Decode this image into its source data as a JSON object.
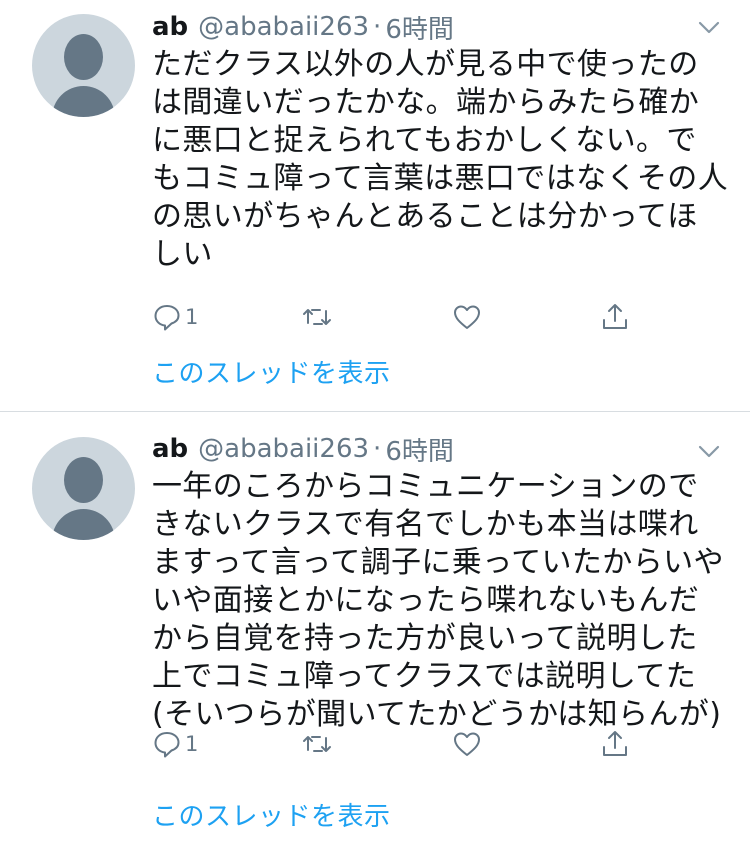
{
  "tweets": [
    {
      "name": "ab",
      "handle": "@ababaii263",
      "separator": "·",
      "time": "6時間",
      "lines": [
        "ただクラス以外の人が見る中で使ったの",
        "は間違いだったかな。端からみたら確か",
        "に悪口と捉えられてもおかしくない。で",
        "もコミュ障って言葉は悪口ではなくその人",
        "の思いがちゃんとあることは分かってほ",
        "しい"
      ],
      "reply_count": "1",
      "thread_link": "このスレッドを表示"
    },
    {
      "name": "ab",
      "handle": "@ababaii263",
      "separator": "·",
      "time": "6時間",
      "lines": [
        "一年のころからコミュニケーションので",
        "きないクラスで有名でしかも本当は喋れ",
        "ますって言って調子に乗っていたからいや",
        "いや面接とかになったら喋れないもんだ",
        "から自覚を持った方が良いって説明した",
        "上でコミュ障ってクラスでは説明してた",
        "(そいつらが聞いてたかどうかは知らんが)"
      ],
      "reply_count": "1",
      "thread_link": "このスレッドを表示"
    }
  ],
  "icons": {
    "reply": "reply-icon",
    "retweet": "retweet-icon",
    "like": "heart-icon",
    "share": "share-icon",
    "caret": "chevron-down-icon",
    "avatar": "default-avatar"
  },
  "colors": {
    "link": "#1da1f2",
    "secondary": "#657786",
    "avatar_bg": "#ccd6dd",
    "divider": "#d8dde1"
  }
}
